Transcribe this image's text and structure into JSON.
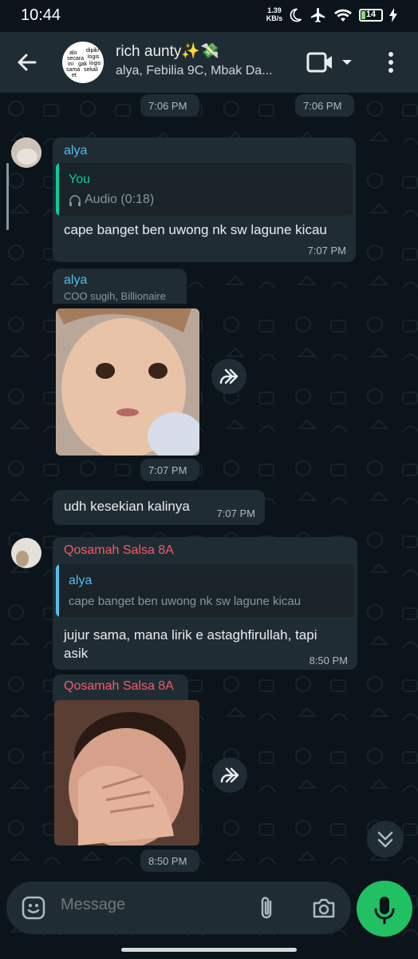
{
  "status_bar": {
    "time": "10:44",
    "net_speed": "1.39",
    "net_unit": "KB/s",
    "battery": "14"
  },
  "header": {
    "title": "rich aunty✨💸",
    "subtitle": "alya, Febilia 9C, Mbak Da...",
    "avatar_text": [
      "alo",
      "dipiki",
      "secara",
      "logis",
      "ini",
      "gak",
      "logis",
      "sama",
      "sekali",
      "et"
    ]
  },
  "messages": [
    {
      "time": "7:06 PM"
    },
    {
      "time": "7:06 PM"
    },
    {
      "sender": "alya",
      "quote_sender": "You",
      "quote_text": "Audio (0:18)",
      "text": "cape banget ben uwong nk sw lagune kicau",
      "time": "7:07 PM"
    },
    {
      "sender": "alya",
      "sender_status": "COO sugih, Billionaire",
      "time": "7:07 PM"
    },
    {
      "text": "udh kesekian kalinya",
      "time": "7:07 PM"
    },
    {
      "sender": "Qosamah Salsa 8A",
      "quote_sender": "alya",
      "quote_text": "cape banget ben uwong nk sw lagune kicau",
      "text_line1": "jujur sama, mana lirik e astaghfirullah, tapi",
      "text_line2": "asik",
      "time": "8:50 PM"
    },
    {
      "sender": "Qosamah Salsa 8A",
      "time": "8:50 PM"
    }
  ],
  "input": {
    "placeholder": "Message"
  },
  "colors": {
    "header_bg": "#1f2c33",
    "bubble_bg": "#202c33",
    "chat_bg": "#0b141a",
    "accent_green": "#21c063",
    "alya_name": "#53bdeb",
    "you_name": "#06cf9c",
    "qosamah_name": "#f15c6d"
  }
}
